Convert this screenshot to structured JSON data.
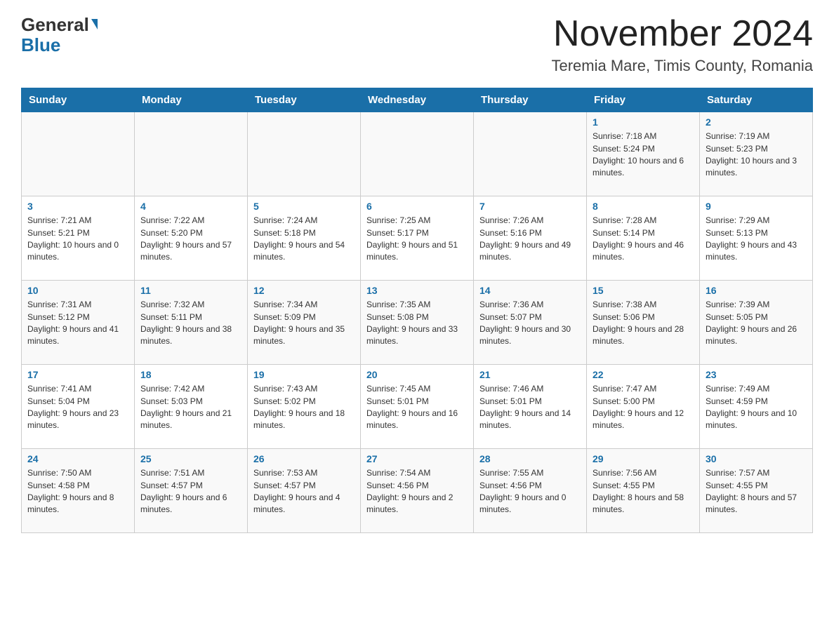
{
  "header": {
    "logo_general": "General",
    "logo_blue": "Blue",
    "month_title": "November 2024",
    "location": "Teremia Mare, Timis County, Romania"
  },
  "weekdays": [
    "Sunday",
    "Monday",
    "Tuesday",
    "Wednesday",
    "Thursday",
    "Friday",
    "Saturday"
  ],
  "weeks": [
    [
      {
        "day": "",
        "sunrise": "",
        "sunset": "",
        "daylight": ""
      },
      {
        "day": "",
        "sunrise": "",
        "sunset": "",
        "daylight": ""
      },
      {
        "day": "",
        "sunrise": "",
        "sunset": "",
        "daylight": ""
      },
      {
        "day": "",
        "sunrise": "",
        "sunset": "",
        "daylight": ""
      },
      {
        "day": "",
        "sunrise": "",
        "sunset": "",
        "daylight": ""
      },
      {
        "day": "1",
        "sunrise": "Sunrise: 7:18 AM",
        "sunset": "Sunset: 5:24 PM",
        "daylight": "Daylight: 10 hours and 6 minutes."
      },
      {
        "day": "2",
        "sunrise": "Sunrise: 7:19 AM",
        "sunset": "Sunset: 5:23 PM",
        "daylight": "Daylight: 10 hours and 3 minutes."
      }
    ],
    [
      {
        "day": "3",
        "sunrise": "Sunrise: 7:21 AM",
        "sunset": "Sunset: 5:21 PM",
        "daylight": "Daylight: 10 hours and 0 minutes."
      },
      {
        "day": "4",
        "sunrise": "Sunrise: 7:22 AM",
        "sunset": "Sunset: 5:20 PM",
        "daylight": "Daylight: 9 hours and 57 minutes."
      },
      {
        "day": "5",
        "sunrise": "Sunrise: 7:24 AM",
        "sunset": "Sunset: 5:18 PM",
        "daylight": "Daylight: 9 hours and 54 minutes."
      },
      {
        "day": "6",
        "sunrise": "Sunrise: 7:25 AM",
        "sunset": "Sunset: 5:17 PM",
        "daylight": "Daylight: 9 hours and 51 minutes."
      },
      {
        "day": "7",
        "sunrise": "Sunrise: 7:26 AM",
        "sunset": "Sunset: 5:16 PM",
        "daylight": "Daylight: 9 hours and 49 minutes."
      },
      {
        "day": "8",
        "sunrise": "Sunrise: 7:28 AM",
        "sunset": "Sunset: 5:14 PM",
        "daylight": "Daylight: 9 hours and 46 minutes."
      },
      {
        "day": "9",
        "sunrise": "Sunrise: 7:29 AM",
        "sunset": "Sunset: 5:13 PM",
        "daylight": "Daylight: 9 hours and 43 minutes."
      }
    ],
    [
      {
        "day": "10",
        "sunrise": "Sunrise: 7:31 AM",
        "sunset": "Sunset: 5:12 PM",
        "daylight": "Daylight: 9 hours and 41 minutes."
      },
      {
        "day": "11",
        "sunrise": "Sunrise: 7:32 AM",
        "sunset": "Sunset: 5:11 PM",
        "daylight": "Daylight: 9 hours and 38 minutes."
      },
      {
        "day": "12",
        "sunrise": "Sunrise: 7:34 AM",
        "sunset": "Sunset: 5:09 PM",
        "daylight": "Daylight: 9 hours and 35 minutes."
      },
      {
        "day": "13",
        "sunrise": "Sunrise: 7:35 AM",
        "sunset": "Sunset: 5:08 PM",
        "daylight": "Daylight: 9 hours and 33 minutes."
      },
      {
        "day": "14",
        "sunrise": "Sunrise: 7:36 AM",
        "sunset": "Sunset: 5:07 PM",
        "daylight": "Daylight: 9 hours and 30 minutes."
      },
      {
        "day": "15",
        "sunrise": "Sunrise: 7:38 AM",
        "sunset": "Sunset: 5:06 PM",
        "daylight": "Daylight: 9 hours and 28 minutes."
      },
      {
        "day": "16",
        "sunrise": "Sunrise: 7:39 AM",
        "sunset": "Sunset: 5:05 PM",
        "daylight": "Daylight: 9 hours and 26 minutes."
      }
    ],
    [
      {
        "day": "17",
        "sunrise": "Sunrise: 7:41 AM",
        "sunset": "Sunset: 5:04 PM",
        "daylight": "Daylight: 9 hours and 23 minutes."
      },
      {
        "day": "18",
        "sunrise": "Sunrise: 7:42 AM",
        "sunset": "Sunset: 5:03 PM",
        "daylight": "Daylight: 9 hours and 21 minutes."
      },
      {
        "day": "19",
        "sunrise": "Sunrise: 7:43 AM",
        "sunset": "Sunset: 5:02 PM",
        "daylight": "Daylight: 9 hours and 18 minutes."
      },
      {
        "day": "20",
        "sunrise": "Sunrise: 7:45 AM",
        "sunset": "Sunset: 5:01 PM",
        "daylight": "Daylight: 9 hours and 16 minutes."
      },
      {
        "day": "21",
        "sunrise": "Sunrise: 7:46 AM",
        "sunset": "Sunset: 5:01 PM",
        "daylight": "Daylight: 9 hours and 14 minutes."
      },
      {
        "day": "22",
        "sunrise": "Sunrise: 7:47 AM",
        "sunset": "Sunset: 5:00 PM",
        "daylight": "Daylight: 9 hours and 12 minutes."
      },
      {
        "day": "23",
        "sunrise": "Sunrise: 7:49 AM",
        "sunset": "Sunset: 4:59 PM",
        "daylight": "Daylight: 9 hours and 10 minutes."
      }
    ],
    [
      {
        "day": "24",
        "sunrise": "Sunrise: 7:50 AM",
        "sunset": "Sunset: 4:58 PM",
        "daylight": "Daylight: 9 hours and 8 minutes."
      },
      {
        "day": "25",
        "sunrise": "Sunrise: 7:51 AM",
        "sunset": "Sunset: 4:57 PM",
        "daylight": "Daylight: 9 hours and 6 minutes."
      },
      {
        "day": "26",
        "sunrise": "Sunrise: 7:53 AM",
        "sunset": "Sunset: 4:57 PM",
        "daylight": "Daylight: 9 hours and 4 minutes."
      },
      {
        "day": "27",
        "sunrise": "Sunrise: 7:54 AM",
        "sunset": "Sunset: 4:56 PM",
        "daylight": "Daylight: 9 hours and 2 minutes."
      },
      {
        "day": "28",
        "sunrise": "Sunrise: 7:55 AM",
        "sunset": "Sunset: 4:56 PM",
        "daylight": "Daylight: 9 hours and 0 minutes."
      },
      {
        "day": "29",
        "sunrise": "Sunrise: 7:56 AM",
        "sunset": "Sunset: 4:55 PM",
        "daylight": "Daylight: 8 hours and 58 minutes."
      },
      {
        "day": "30",
        "sunrise": "Sunrise: 7:57 AM",
        "sunset": "Sunset: 4:55 PM",
        "daylight": "Daylight: 8 hours and 57 minutes."
      }
    ]
  ]
}
